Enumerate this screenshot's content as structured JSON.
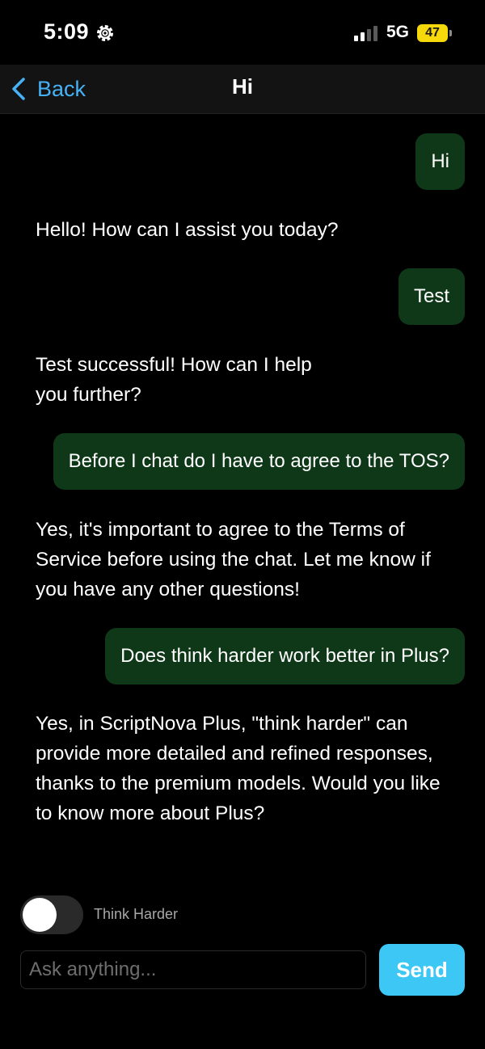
{
  "status": {
    "time": "5:09",
    "network": "5G",
    "battery": "47",
    "icons": {
      "settings": "gear-icon",
      "signal": "signal-bars-icon",
      "battery": "battery-icon"
    }
  },
  "nav": {
    "back_label": "Back",
    "title": "Hi",
    "icons": {
      "back": "chevron-left-icon"
    }
  },
  "messages": [
    {
      "role": "user",
      "text": "Hi"
    },
    {
      "role": "assistant",
      "text": "Hello! How can I assist you today?"
    },
    {
      "role": "user",
      "text": "Test"
    },
    {
      "role": "assistant",
      "line1": "Test successful! How can I help",
      "line2": "you further?"
    },
    {
      "role": "user",
      "text": "Before I chat do I have to agree to the TOS?"
    },
    {
      "role": "assistant",
      "text": "Yes, it's important to agree to the Terms of Service before using the chat. Let me know if you have any other questions!"
    },
    {
      "role": "user",
      "text": "Does think harder work better in Plus?"
    },
    {
      "role": "assistant",
      "text": "Yes, in ScriptNova Plus, \"think harder\" can provide more detailed and refined responses, thanks to the premium models. Would you like to know more about Plus?"
    }
  ],
  "composer": {
    "toggle_label": "Think Harder",
    "toggle_on": false,
    "input_value": "",
    "input_placeholder": "Ask anything...",
    "send_label": "Send"
  },
  "colors": {
    "background": "#000000",
    "nav_background": "#131313",
    "user_bubble": "#0f3819",
    "accent_link": "#46b2f5",
    "send_button": "#3dc7f5",
    "battery": "#f5d90a"
  }
}
